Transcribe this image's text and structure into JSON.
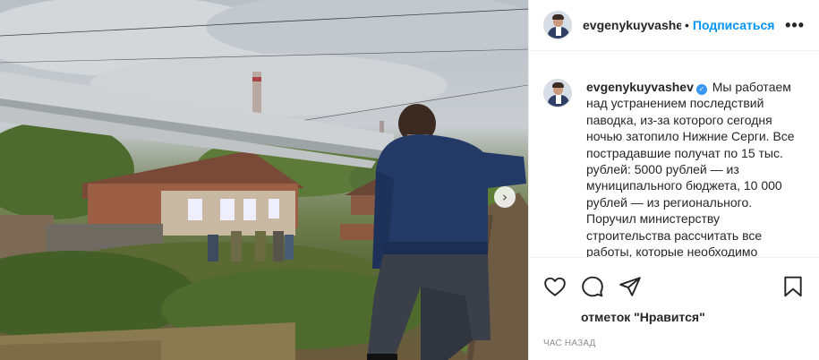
{
  "post": {
    "author": "evgenykuyvashev",
    "header_username": "evgenykuyvashe",
    "follow_label": "Подписаться",
    "separator": "•",
    "more_label": "•••",
    "caption": "Мы работаем над устранением последствий паводка, из-за которого сегодня ночью затопило Нижние Серги. Все пострадавшие получат по 15 тыс. рублей: 5000 рублей — из муниципального бюджета, 10 000 рублей — из регионального. Поручил министерству строительства рассчитать все работы, которые необходимо",
    "verified_mark": "✓",
    "likes_text": "отметок \"Нравится\"",
    "time_text": "час назад",
    "next_arrow": "›"
  },
  "icons": {
    "like": "heart-icon",
    "comment": "comment-icon",
    "share": "share-icon",
    "save": "bookmark-icon",
    "more": "more-icon"
  },
  "colors": {
    "follow": "#0095f6",
    "verified": "#3897f0",
    "text": "#262626",
    "muted": "#8e8e8e"
  }
}
